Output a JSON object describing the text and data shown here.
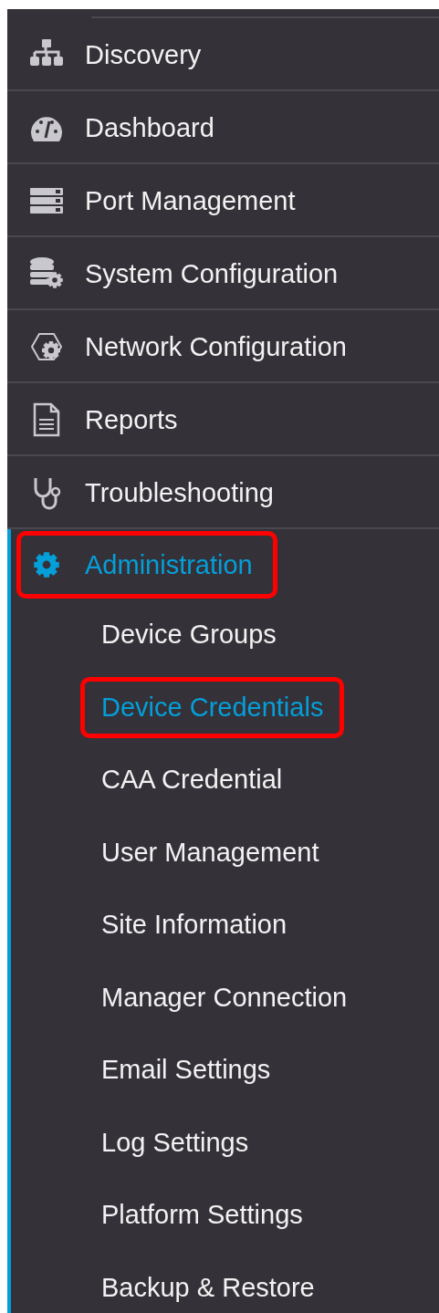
{
  "menu": {
    "items": [
      {
        "label": "Discovery",
        "selected": false,
        "highlighted": false
      },
      {
        "label": "Dashboard",
        "selected": false,
        "highlighted": false
      },
      {
        "label": "Port Management",
        "selected": false,
        "highlighted": false
      },
      {
        "label": "System Configuration",
        "selected": false,
        "highlighted": false
      },
      {
        "label": "Network Configuration",
        "selected": false,
        "highlighted": false
      },
      {
        "label": "Reports",
        "selected": false,
        "highlighted": false
      },
      {
        "label": "Troubleshooting",
        "selected": false,
        "highlighted": false
      },
      {
        "label": "Administration",
        "selected": true,
        "expanded": true,
        "highlighted": true,
        "children": [
          {
            "label": "Device Groups",
            "selected": false,
            "highlighted": false
          },
          {
            "label": "Device Credentials",
            "selected": true,
            "highlighted": true
          },
          {
            "label": "CAA Credential",
            "selected": false,
            "highlighted": false
          },
          {
            "label": "User Management",
            "selected": false,
            "highlighted": false
          },
          {
            "label": "Site Information",
            "selected": false,
            "highlighted": false
          },
          {
            "label": "Manager Connection",
            "selected": false,
            "highlighted": false
          },
          {
            "label": "Email Settings",
            "selected": false,
            "highlighted": false
          },
          {
            "label": "Log Settings",
            "selected": false,
            "highlighted": false
          },
          {
            "label": "Platform Settings",
            "selected": false,
            "highlighted": false
          },
          {
            "label": "Backup & Restore",
            "selected": false,
            "highlighted": false
          }
        ]
      }
    ]
  }
}
